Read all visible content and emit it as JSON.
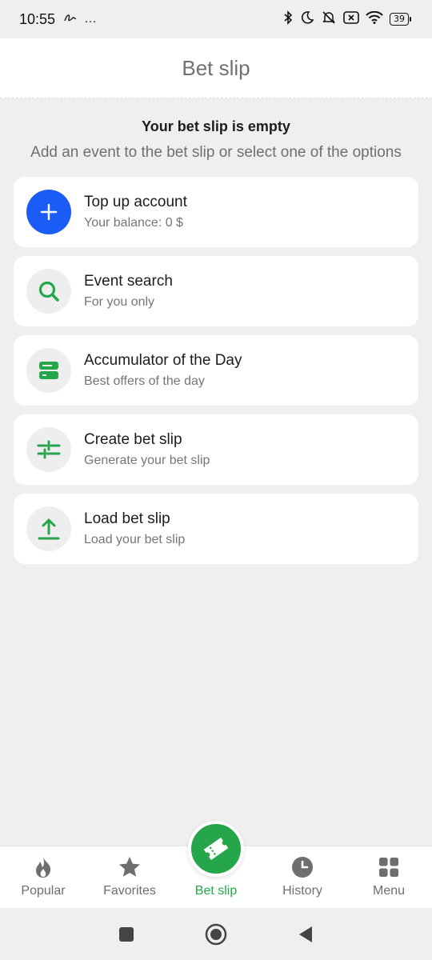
{
  "status_bar": {
    "time": "10:55",
    "extra": "…",
    "battery": "39"
  },
  "header": {
    "title": "Bet slip"
  },
  "empty_state": {
    "title": "Your bet slip is empty",
    "subtitle": "Add an event to the bet slip or select one of the options"
  },
  "options": [
    {
      "title": "Top up account",
      "subtitle": "Your balance: 0 $",
      "icon": "plus-icon"
    },
    {
      "title": "Event search",
      "subtitle": "For you only",
      "icon": "search-icon"
    },
    {
      "title": "Accumulator of the Day",
      "subtitle": "Best offers of the day",
      "icon": "accumulator-icon"
    },
    {
      "title": "Create bet slip",
      "subtitle": "Generate your bet slip",
      "icon": "sliders-icon"
    },
    {
      "title": "Load bet slip",
      "subtitle": "Load your bet slip",
      "icon": "upload-icon"
    }
  ],
  "bottom_nav": [
    {
      "label": "Popular",
      "icon": "flame-icon"
    },
    {
      "label": "Favorites",
      "icon": "star-icon"
    },
    {
      "label": "Bet slip",
      "icon": "ticket-icon",
      "active": true
    },
    {
      "label": "History",
      "icon": "clock-icon"
    },
    {
      "label": "Menu",
      "icon": "grid-icon"
    }
  ],
  "colors": {
    "accent_green": "#26a64a",
    "blue": "#1a5cf5",
    "background": "#efefef"
  }
}
